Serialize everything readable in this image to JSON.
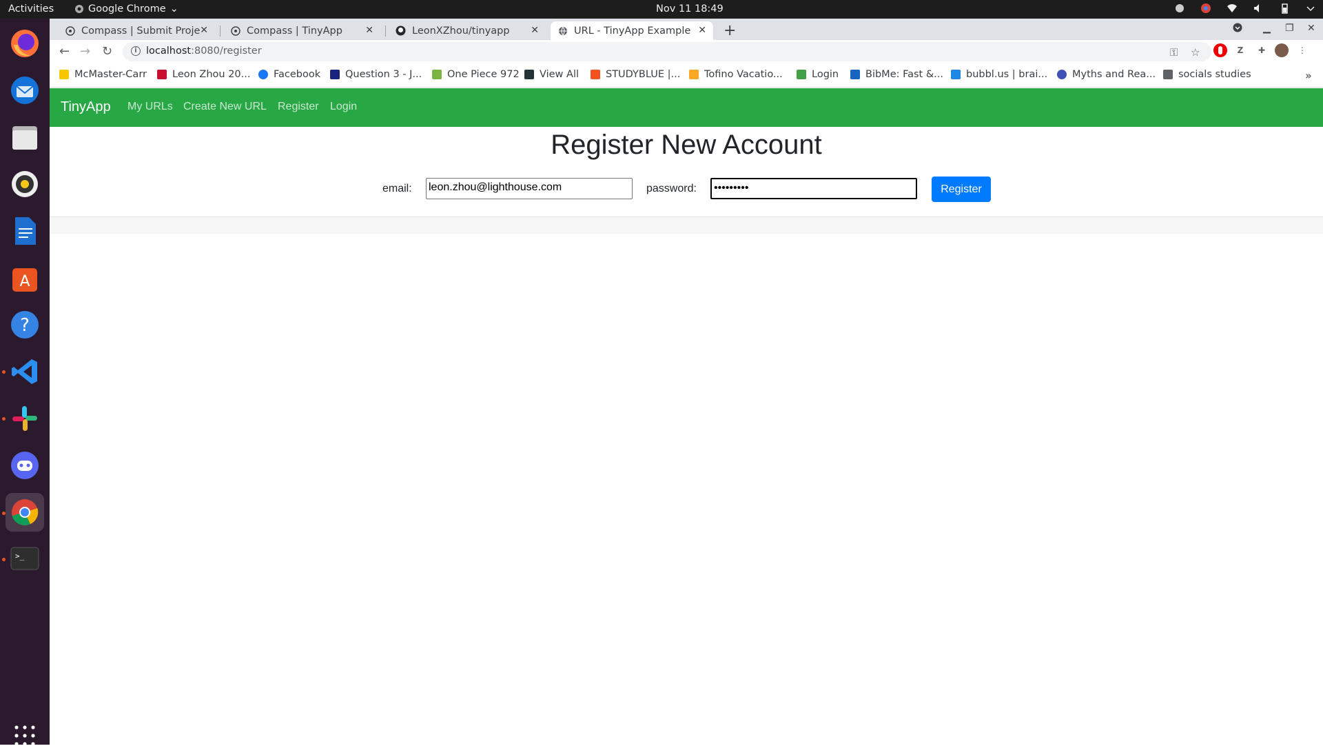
{
  "system": {
    "activities": "Activities",
    "app_name": "Google Chrome",
    "clock": "Nov 11  18:49"
  },
  "browser": {
    "tabs": [
      {
        "title": "Compass | Submit Project"
      },
      {
        "title": "Compass | TinyApp"
      },
      {
        "title": "LeonXZhou/tinyapp"
      },
      {
        "title": "URL - TinyApp Example"
      }
    ],
    "url_host": "localhost",
    "url_path": ":8080/register",
    "bookmarks": [
      {
        "label": "McMaster-Carr",
        "color": "#f6c700"
      },
      {
        "label": "Leon Zhou 20...",
        "color": "#c8102e"
      },
      {
        "label": "Facebook",
        "color": "#1877f2"
      },
      {
        "label": "Question 3 - J...",
        "color": "#1a237e"
      },
      {
        "label": "One Piece 972",
        "color": "#7cb342"
      },
      {
        "label": "View All",
        "color": "#263238"
      },
      {
        "label": "STUDYBLUE |...",
        "color": "#f4511e"
      },
      {
        "label": "Tofino Vacatio...",
        "color": "#f9a825"
      },
      {
        "label": "Login",
        "color": "#43a047"
      },
      {
        "label": "BibMe: Fast &...",
        "color": "#1565c0"
      },
      {
        "label": "bubbl.us | brai...",
        "color": "#1e88e5"
      },
      {
        "label": "Myths and Rea...",
        "color": "#3f51b5"
      },
      {
        "label": "socials studies",
        "color": "#5f6368"
      }
    ],
    "more_bookmarks": "»"
  },
  "app": {
    "brand": "TinyApp",
    "nav": {
      "my_urls": "My URLs",
      "create_new_url": "Create New URL",
      "register": "Register",
      "login": "Login"
    },
    "heading": "Register New Account",
    "form": {
      "email_label": "email:",
      "email_value": "leon.zhou@lighthouse.com",
      "password_label": "password:",
      "password_value": "•••••••••",
      "submit_label": "Register"
    },
    "colors": {
      "navbar": "#28a745",
      "button": "#007bff"
    }
  }
}
